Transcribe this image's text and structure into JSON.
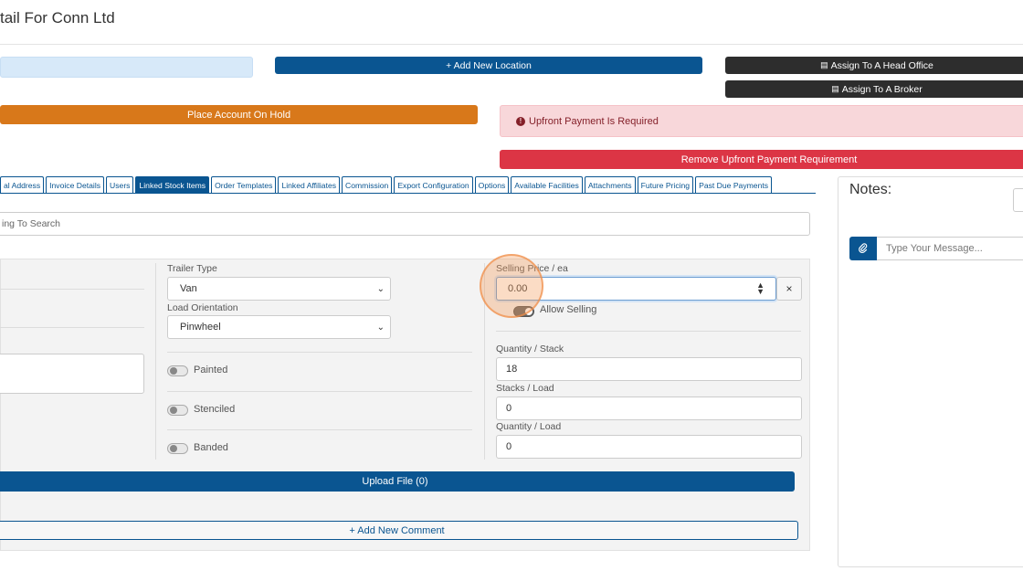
{
  "header": {
    "title": "tail For Conn Ltd"
  },
  "actions": {
    "add_location": "+ Add New Location",
    "assign_head_office": "Assign To A Head Office",
    "assign_broker": "Assign To A Broker",
    "place_on_hold": "Place Account On Hold",
    "upfront_alert": "Upfront Payment Is Required",
    "remove_upfront": "Remove Upfront Payment Requirement"
  },
  "tabs": [
    {
      "label": "al Address"
    },
    {
      "label": "Invoice Details"
    },
    {
      "label": "Users"
    },
    {
      "label": "Linked Stock Items",
      "active": true
    },
    {
      "label": "Order Templates"
    },
    {
      "label": "Linked Affiliates"
    },
    {
      "label": "Commission"
    },
    {
      "label": "Export Configuration"
    },
    {
      "label": "Options"
    },
    {
      "label": "Available Facilities"
    },
    {
      "label": "Attachments"
    },
    {
      "label": "Future Pricing"
    },
    {
      "label": "Past Due Payments"
    }
  ],
  "search": {
    "placeholder": "ing To Search"
  },
  "form": {
    "trailer_type_label": "Trailer Type",
    "trailer_type_value": "Van",
    "load_orientation_label": "Load Orientation",
    "load_orientation_value": "Pinwheel",
    "painted_label": "Painted",
    "stenciled_label": "Stenciled",
    "banded_label": "Banded",
    "selling_price_label": "Selling Price / ea",
    "selling_price_value": "0.00",
    "allow_selling_label": "Allow Selling",
    "quantity_stack_label": "Quantity / Stack",
    "quantity_stack_value": "18",
    "stacks_load_label": "Stacks / Load",
    "stacks_load_value": "0",
    "quantity_load_label": "Quantity / Load",
    "quantity_load_value": "0",
    "upload_label": "Upload File (0)",
    "add_comment_label": "+ Add New Comment",
    "clear_symbol": "×"
  },
  "notes": {
    "title": "Notes:",
    "message_placeholder": "Type Your Message..."
  },
  "icons": [
    "building-icon",
    "exclamation-circle-icon",
    "paperclip-icon",
    "chevron-down-icon",
    "spinner-arrows-icon",
    "close-icon"
  ],
  "colors": {
    "primary": "#0a5591",
    "dark": "#2d2d2d",
    "orange": "#d8781a",
    "danger": "#dc3545",
    "alert_bg": "#f8d7da"
  }
}
